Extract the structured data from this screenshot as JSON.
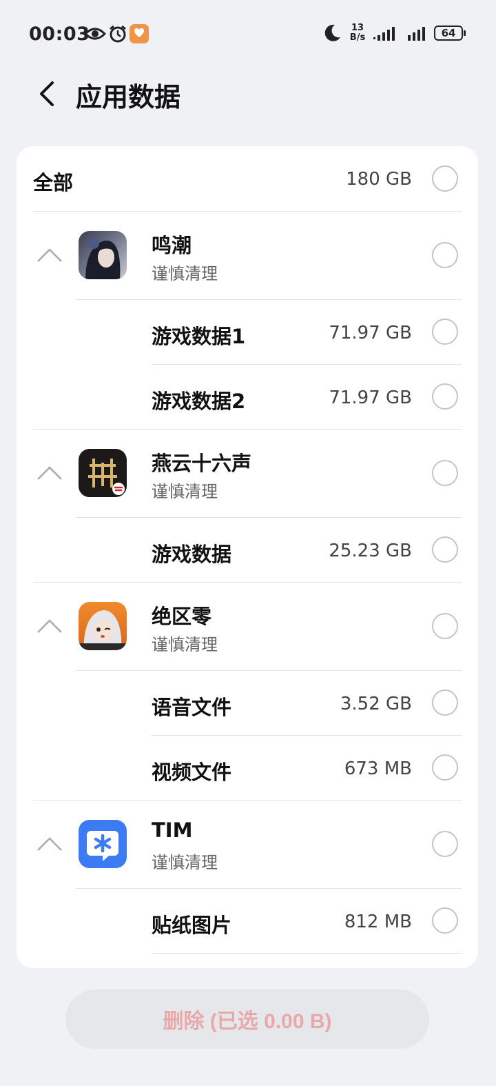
{
  "status_bar": {
    "time": "00:03",
    "net_speed_value": "13",
    "net_speed_unit": "B/s",
    "battery": "64",
    "icons": [
      "eye-icon",
      "alarm-icon",
      "app-notification-icon",
      "moon-icon",
      "signal-icon",
      "signal-icon",
      "battery-icon"
    ]
  },
  "header": {
    "back_icon": "chevron-left-icon",
    "title": "应用数据"
  },
  "list": {
    "all": {
      "label": "全部",
      "size": "180 GB"
    },
    "apps": [
      {
        "name": "鸣潮",
        "sub": "谨慎清理",
        "icon": "wuthering-waves-app-icon",
        "items": [
          {
            "label": "游戏数据1",
            "size": "71.97 GB"
          },
          {
            "label": "游戏数据2",
            "size": "71.97 GB"
          }
        ]
      },
      {
        "name": "燕云十六声",
        "sub": "谨慎清理",
        "icon": "yanyun-app-icon",
        "items": [
          {
            "label": "游戏数据",
            "size": "25.23 GB"
          }
        ]
      },
      {
        "name": "绝区零",
        "sub": "谨慎清理",
        "icon": "zenless-zone-zero-app-icon",
        "items": [
          {
            "label": "语音文件",
            "size": "3.52 GB"
          },
          {
            "label": "视频文件",
            "size": "673 MB"
          }
        ]
      },
      {
        "name": "TIM",
        "sub": "谨慎清理",
        "icon": "tim-app-icon",
        "items": [
          {
            "label": "贴纸图片",
            "size": "812 MB"
          }
        ]
      }
    ]
  },
  "footer": {
    "delete_label": "删除 (已选 0.00 B)"
  },
  "colors": {
    "background": "#f0f1f5",
    "card": "#ffffff",
    "delete_text": "#e8a9ab",
    "delete_bg": "#e6e7ea",
    "tim_blue": "#3d7bf5"
  }
}
